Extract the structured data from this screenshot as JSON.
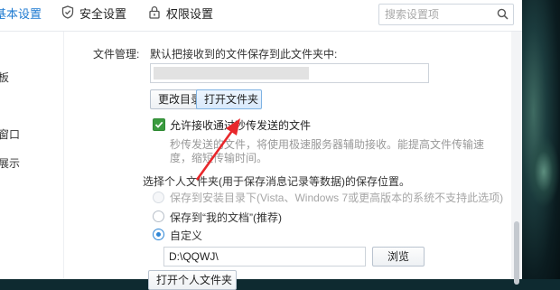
{
  "tabs": [
    {
      "label": "基本设置",
      "icon": "settings-icon",
      "active": true
    },
    {
      "label": "安全设置",
      "icon": "shield-icon",
      "active": false
    },
    {
      "label": "权限设置",
      "icon": "lock-icon",
      "active": false
    }
  ],
  "search": {
    "placeholder": "搜索设置项",
    "icon": "search-icon"
  },
  "sidebar": {
    "items": [
      "板",
      "窗口",
      "展示"
    ]
  },
  "file_mgmt": {
    "section_label": "文件管理:",
    "save_desc": "默认把接收到的文件保存到此文件夹中:",
    "change_dir_button": "更改目录",
    "open_folder_button": "打开文件夹"
  },
  "instant_send": {
    "checkbox_label": "允许接收通过秒传发送的文件",
    "checked": true,
    "desc_line1": "秒传发送的文件，将使用极速服务器辅助接收。能提高文件传输速",
    "desc_line2": "度，缩短传输时间。"
  },
  "personal_folder": {
    "prompt": "选择个人文件夹(用于保存消息记录等数据)的保存位置。",
    "options": [
      {
        "label": "保存到安装目录下(Vista、Windows 7或更高版本的系统不支持此选项)",
        "state": "disabled"
      },
      {
        "label": "保存到“我的文档”(推荐)",
        "state": "unchecked"
      },
      {
        "label": "自定义",
        "state": "checked"
      }
    ],
    "custom_path": "D:\\QQWJ\\",
    "browse_button": "浏览",
    "open_personal_button": "打开个人文件夹"
  },
  "colors": {
    "accent": "#1e7ad1",
    "check_green": "#3a9b3f",
    "annotation_arrow": "#e8272b"
  }
}
